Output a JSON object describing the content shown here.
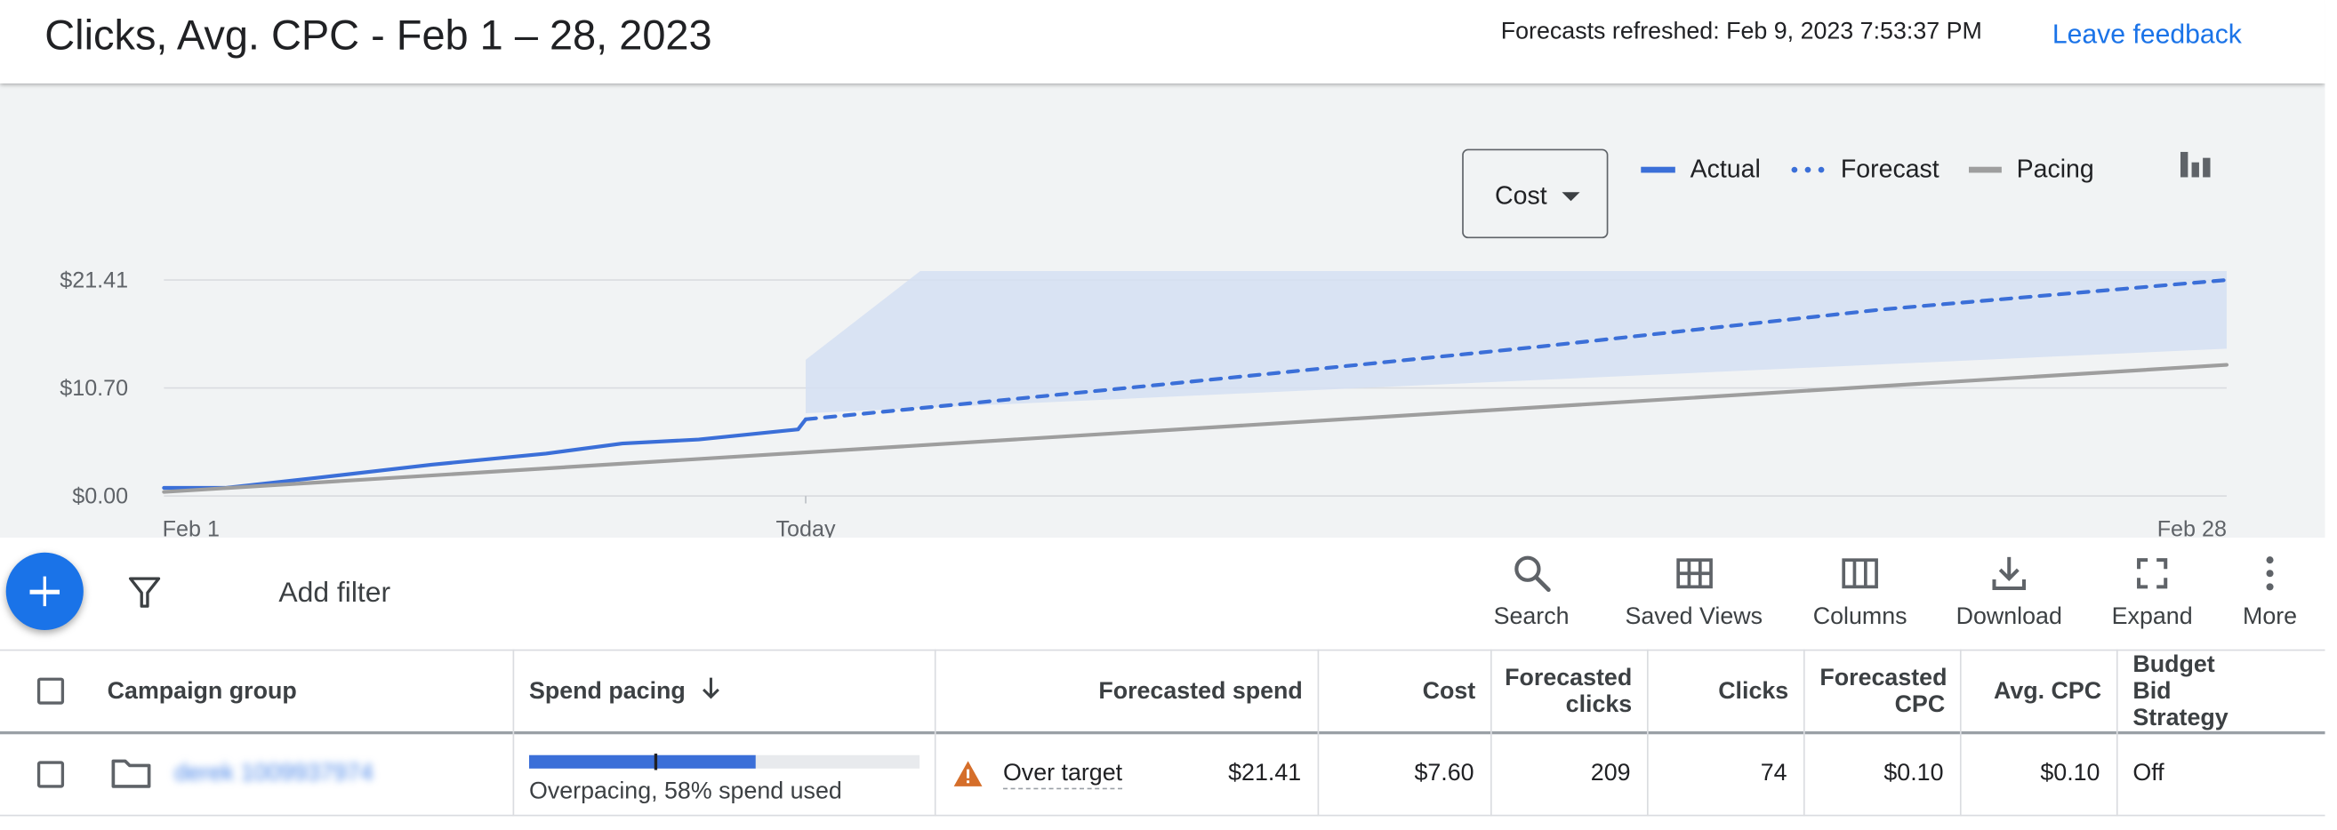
{
  "header": {
    "title": "Clicks, Avg. CPC - Feb 1 – 28, 2023",
    "refreshed": "Forecasts refreshed: Feb 9, 2023 7:53:37 PM",
    "feedback_label": "Leave feedback"
  },
  "chart": {
    "metric_select": "Cost",
    "legend": [
      {
        "label": "Actual",
        "style": "solid",
        "color": "#3b6fd8"
      },
      {
        "label": "Forecast",
        "style": "dotted",
        "color": "#3b6fd8"
      },
      {
        "label": "Pacing",
        "style": "solid",
        "color": "#9e9e9e"
      }
    ],
    "chart_type_icon": "bar-chart-icon"
  },
  "chart_data": {
    "type": "line",
    "x": [
      "Feb 1",
      "Today",
      "Feb 28"
    ],
    "x_ticks": [
      "Feb 1",
      "Today",
      "Feb 28"
    ],
    "y_ticks": [
      "$21.41",
      "$10.70",
      "$0.00"
    ],
    "ylim": [
      0,
      21.41
    ],
    "days": [
      1,
      28
    ],
    "today_day": 9.4,
    "series": [
      {
        "name": "Actual",
        "color": "#3b6fd8",
        "style": "solid",
        "points": [
          [
            1,
            0.8
          ],
          [
            1.8,
            0.8
          ],
          [
            3,
            1.8
          ],
          [
            4.5,
            3.1
          ],
          [
            6,
            4.2
          ],
          [
            7,
            5.2
          ],
          [
            8,
            5.6
          ],
          [
            9.3,
            6.6
          ],
          [
            9.4,
            7.6
          ]
        ]
      },
      {
        "name": "Forecast",
        "color": "#3b6fd8",
        "style": "dotted",
        "points": [
          [
            9.4,
            7.6
          ],
          [
            14,
            11.0
          ],
          [
            19,
            14.8
          ],
          [
            23.5,
            18.5
          ],
          [
            28,
            21.41
          ]
        ]
      },
      {
        "name": "Pacing",
        "color": "#9e9e9e",
        "style": "solid",
        "points": [
          [
            1,
            0.4
          ],
          [
            28,
            13.0
          ]
        ]
      }
    ],
    "forecast_band": {
      "upper": [
        [
          9.4,
          13.5
        ],
        [
          10.9,
          22.3
        ],
        [
          28,
          22.3
        ]
      ],
      "lower": [
        [
          28,
          14.6
        ],
        [
          9.4,
          8.2
        ]
      ],
      "color": "#d5dff2"
    },
    "grid": true
  },
  "toolbar": {
    "add_icon": "plus-icon",
    "filter_icon": "filter-icon",
    "add_filter": "Add filter",
    "tools": [
      {
        "label": "Search",
        "icon": "search-icon"
      },
      {
        "label": "Saved Views",
        "icon": "grid-icon"
      },
      {
        "label": "Columns",
        "icon": "columns-icon"
      },
      {
        "label": "Download",
        "icon": "download-icon"
      },
      {
        "label": "Expand",
        "icon": "expand-icon"
      },
      {
        "label": "More",
        "icon": "more-vert-icon"
      }
    ]
  },
  "table": {
    "columns": [
      "Campaign group",
      "Spend pacing",
      "Forecasted spend",
      "Cost",
      "Forecasted clicks",
      "Clicks",
      "Forecasted CPC",
      "Avg. CPC",
      "Budget Bid Strategy"
    ],
    "rows": [
      {
        "campaign_group": "derek 1009937974",
        "spend_pacing": {
          "used": 0.58,
          "marker": 0.32,
          "text": "Overpacing, 58% spend used"
        },
        "forecast_status": "Over target",
        "forecasted_spend": "$21.41",
        "cost": "$7.60",
        "forecasted_clicks": "209",
        "clicks": "74",
        "forecasted_cpc": "$0.10",
        "avg_cpc": "$0.10",
        "budget_bid_strategy": "Off"
      }
    ]
  }
}
